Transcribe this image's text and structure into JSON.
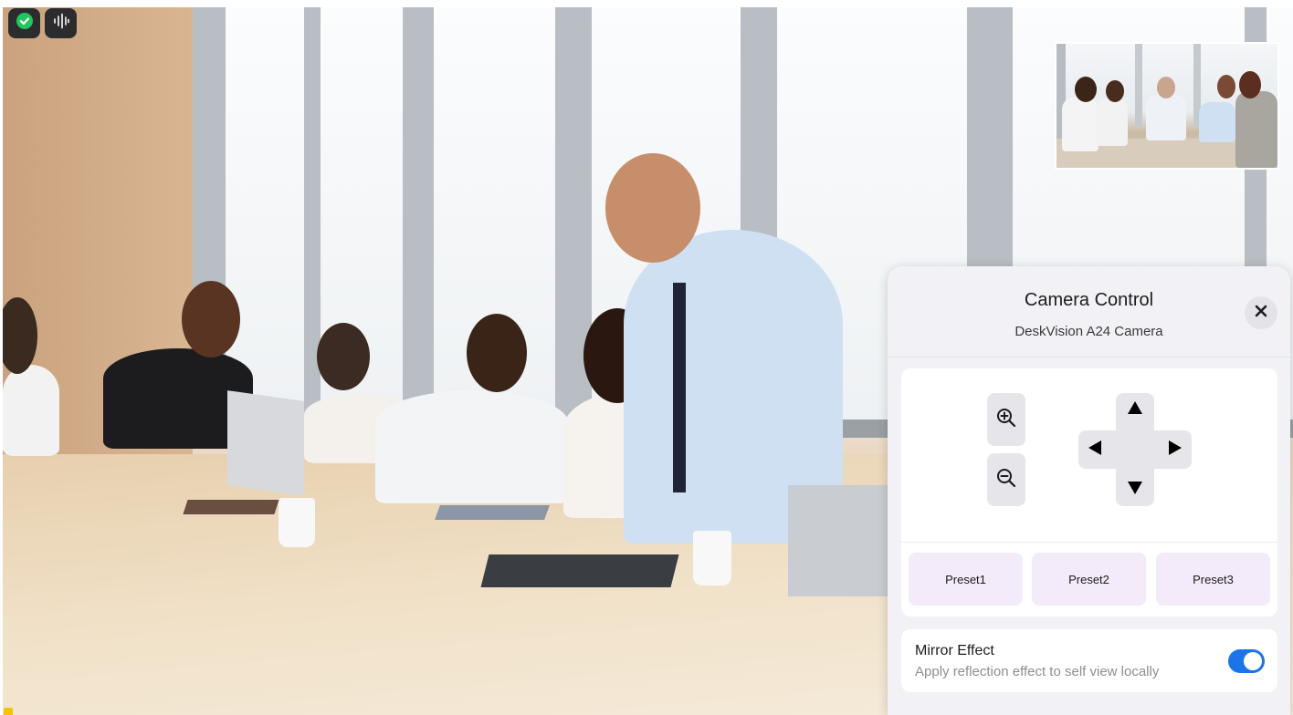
{
  "camera_panel": {
    "title": "Camera Control",
    "camera_name": "DeskVision A24 Camera",
    "presets": [
      "Preset1",
      "Preset2",
      "Preset3"
    ],
    "mirror": {
      "title": "Mirror Effect",
      "description": "Apply reflection effect to self view locally",
      "enabled": true
    }
  },
  "icons": {
    "shield": "shield-check-icon",
    "audio": "audio-waveform-icon",
    "close": "close-icon",
    "zoom_in": "zoom-in-icon",
    "zoom_out": "zoom-out-icon",
    "pan": [
      "arrow-up-icon",
      "arrow-down-icon",
      "arrow-left-icon",
      "arrow-right-icon"
    ]
  },
  "colors": {
    "shield_green": "#22c55e",
    "toggle_on": "#1d74e8",
    "preset_bg": "#f3ebf9",
    "panel_bg": "#f2f2f6"
  }
}
